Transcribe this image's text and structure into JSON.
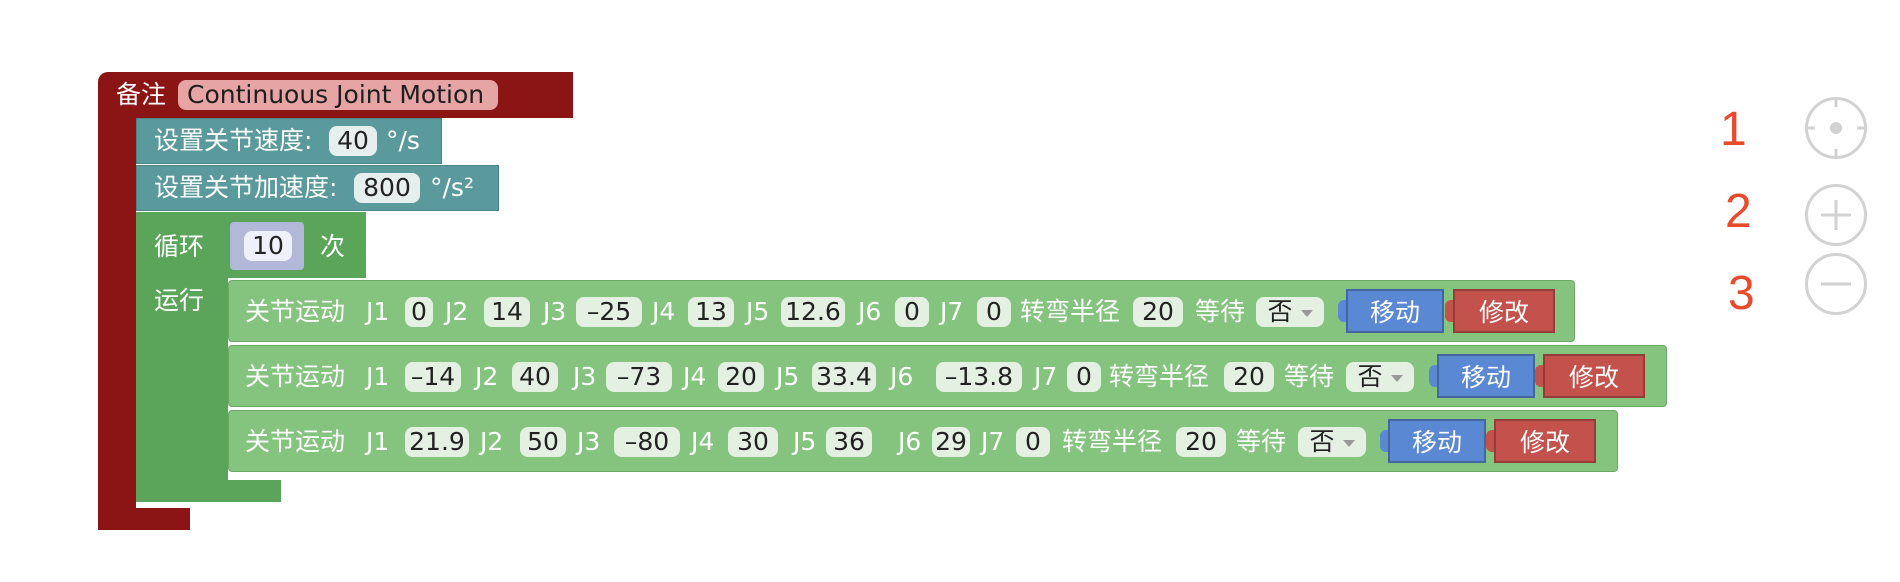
{
  "comment_block": {
    "label": "备注",
    "text": "Continuous Joint Motion"
  },
  "set_speed": {
    "label": "设置关节速度:",
    "value": "40",
    "unit": "°/s"
  },
  "set_accel": {
    "label": "设置关节加速度:",
    "value": "800",
    "unit": "°/s²"
  },
  "loop": {
    "label": "循环",
    "count": "10",
    "suffix": "次",
    "run_label": "运行"
  },
  "motion_common": {
    "label": "关节运动",
    "j1": "J1",
    "j2": "J2",
    "j3": "J3",
    "j4": "J4",
    "j5": "J5",
    "j6": "J6",
    "j7": "J7",
    "radius_label": "转弯半径",
    "wait_label": "等待",
    "move_button": "移动",
    "modify_button": "修改"
  },
  "motions": [
    {
      "j1": "0",
      "j2": "14",
      "j3": "–25",
      "j4": "13",
      "j5": "12.6",
      "j6": "0",
      "j7": "0",
      "radius": "20",
      "wait": "否"
    },
    {
      "j1": "–14",
      "j2": "40",
      "j3": "–73",
      "j4": "20",
      "j5": "33.4",
      "j6": "–13.8",
      "j7": "0",
      "radius": "20",
      "wait": "否"
    },
    {
      "j1": "21.9",
      "j2": "50",
      "j3": "–80",
      "j4": "30",
      "j5": "36",
      "j6": "29",
      "j7": "0",
      "radius": "20",
      "wait": "否"
    }
  ],
  "annotations": [
    "1",
    "2",
    "3"
  ],
  "controls": {
    "recenter_icon": "crosshair-icon",
    "zoom_in_icon": "plus-icon",
    "zoom_out_icon": "minus-icon"
  },
  "colors": {
    "comment": "#8b1414",
    "teal": "#5b9a9c",
    "loop": "#5ba55b",
    "motion": "#85c47f",
    "move": "#5b88d3",
    "modify": "#c4524c"
  }
}
